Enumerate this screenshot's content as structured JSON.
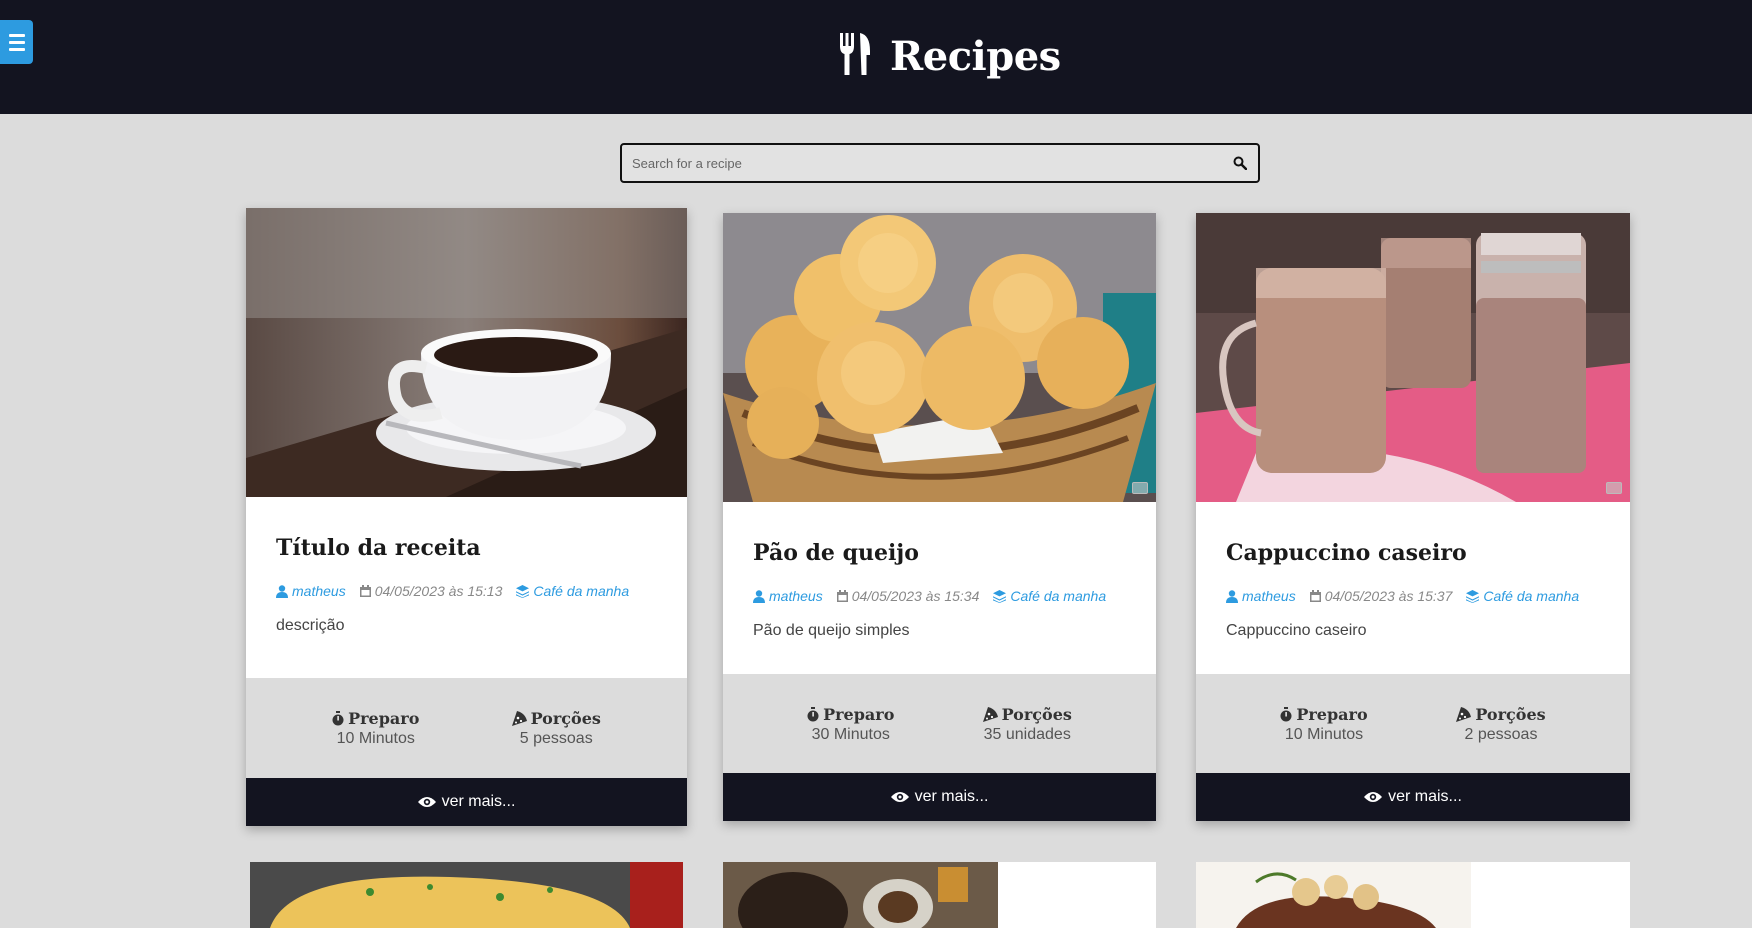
{
  "header": {
    "title": "Recipes",
    "logo_icon": "utensils-icon",
    "menu_icon": "hamburger-menu-icon",
    "bg_color": "#131420",
    "accent_color": "#2d9be0"
  },
  "search": {
    "placeholder": "Search for a recipe",
    "value": "",
    "icon": "search-icon"
  },
  "cards": [
    {
      "title": "Título da receita",
      "author": "matheus",
      "date": "04/05/2023 às 15:13",
      "category": "Café da manha",
      "description": "descrição",
      "prep_label": "Preparo",
      "prep_value": "10 Minutos",
      "servings_label": "Porções",
      "servings_value": "5 pessoas",
      "more_label": "ver mais...",
      "image": "coffee-cup-photo"
    },
    {
      "title": "Pão de queijo",
      "author": "matheus",
      "date": "04/05/2023 às 15:34",
      "category": "Café da manha",
      "description": "Pão de queijo simples",
      "prep_label": "Preparo",
      "prep_value": "30 Minutos",
      "servings_label": "Porções",
      "servings_value": "35 unidades",
      "more_label": "ver mais...",
      "image": "cheese-bread-basket-photo"
    },
    {
      "title": "Cappuccino caseiro",
      "author": "matheus",
      "date": "04/05/2023 às 15:37",
      "category": "Café da manha",
      "description": "Cappuccino caseiro",
      "prep_label": "Preparo",
      "prep_value": "10 Minutos",
      "servings_label": "Porções",
      "servings_value": "2 pessoas",
      "more_label": "ver mais...",
      "image": "cappuccino-mugs-photo"
    }
  ]
}
